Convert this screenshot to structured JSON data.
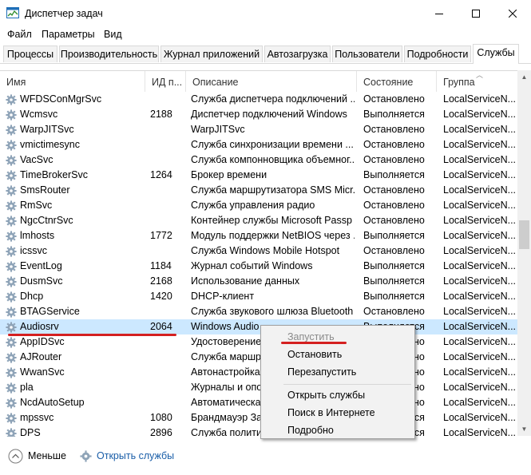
{
  "window": {
    "title": "Диспетчер задач",
    "minimize_icon": "minimize-icon",
    "maximize_icon": "maximize-icon",
    "close_icon": "close-icon"
  },
  "menu": [
    "Файл",
    "Параметры",
    "Вид"
  ],
  "tabs": [
    "Процессы",
    "Производительность",
    "Журнал приложений",
    "Автозагрузка",
    "Пользователи",
    "Подробности",
    "Службы"
  ],
  "active_tab": "Службы",
  "columns": [
    "Имя",
    "ИД п...",
    "Описание",
    "Состояние",
    "Группа"
  ],
  "rows": [
    {
      "name": "WFDSConMgrSvc",
      "pid": "",
      "desc": "Служба диспетчера подключений ...",
      "state": "Остановлено",
      "group": "LocalServiceN..."
    },
    {
      "name": "Wcmsvc",
      "pid": "2188",
      "desc": "Диспетчер подключений Windows",
      "state": "Выполняется",
      "group": "LocalServiceN..."
    },
    {
      "name": "WarpJITSvc",
      "pid": "",
      "desc": "WarpJITSvc",
      "state": "Остановлено",
      "group": "LocalServiceN..."
    },
    {
      "name": "vmictimesync",
      "pid": "",
      "desc": "Служба синхронизации времени ...",
      "state": "Остановлено",
      "group": "LocalServiceN..."
    },
    {
      "name": "VacSvc",
      "pid": "",
      "desc": "Служба компонновщика объемног...",
      "state": "Остановлено",
      "group": "LocalServiceN..."
    },
    {
      "name": "TimeBrokerSvc",
      "pid": "1264",
      "desc": "Брокер времени",
      "state": "Выполняется",
      "group": "LocalServiceN..."
    },
    {
      "name": "SmsRouter",
      "pid": "",
      "desc": "Служба маршрутизатора SMS Micr...",
      "state": "Остановлено",
      "group": "LocalServiceN..."
    },
    {
      "name": "RmSvc",
      "pid": "",
      "desc": "Служба управления радио",
      "state": "Остановлено",
      "group": "LocalServiceN..."
    },
    {
      "name": "NgcCtnrSvc",
      "pid": "",
      "desc": "Контейнер службы Microsoft Passp",
      "state": "Остановлено",
      "group": "LocalServiceN..."
    },
    {
      "name": "lmhosts",
      "pid": "1772",
      "desc": "Модуль поддержки NetBIOS через ...",
      "state": "Выполняется",
      "group": "LocalServiceN..."
    },
    {
      "name": "icssvc",
      "pid": "",
      "desc": "Служба Windows Mobile Hotspot",
      "state": "Остановлено",
      "group": "LocalServiceN..."
    },
    {
      "name": "EventLog",
      "pid": "1184",
      "desc": "Журнал событий Windows",
      "state": "Выполняется",
      "group": "LocalServiceN..."
    },
    {
      "name": "DusmSvc",
      "pid": "2168",
      "desc": "Использование данных",
      "state": "Выполняется",
      "group": "LocalServiceN..."
    },
    {
      "name": "Dhcp",
      "pid": "1420",
      "desc": "DHCP-клиент",
      "state": "Выполняется",
      "group": "LocalServiceN..."
    },
    {
      "name": "BTAGService",
      "pid": "",
      "desc": "Служба звукового шлюза Bluetooth",
      "state": "Остановлено",
      "group": "LocalServiceN..."
    },
    {
      "name": "Audiosrv",
      "pid": "2064",
      "desc": "Windows Audio",
      "state": "Выполняется",
      "group": "LocalServiceN...",
      "selected": true
    },
    {
      "name": "AppIDSvc",
      "pid": "",
      "desc": "Удостоверение приложения",
      "state": "Остановлено",
      "group": "LocalServiceN..."
    },
    {
      "name": "AJRouter",
      "pid": "",
      "desc": "Служба маршрутизатора AllJoyn",
      "state": "Остановлено",
      "group": "LocalServiceN..."
    },
    {
      "name": "WwanSvc",
      "pid": "",
      "desc": "Автонастройка WWAN",
      "state": "Остановлено",
      "group": "LocalServiceN..."
    },
    {
      "name": "pla",
      "pid": "",
      "desc": "Журналы и оповещения производит...",
      "state": "Остановлено",
      "group": "LocalServiceN..."
    },
    {
      "name": "NcdAutoSetup",
      "pid": "",
      "desc": "Автоматическая настройка сетевых...",
      "state": "Остановлено",
      "group": "LocalServiceN..."
    },
    {
      "name": "mpssvc",
      "pid": "1080",
      "desc": "Брандмауэр Защитника Windows",
      "state": "Выполняется",
      "group": "LocalServiceN..."
    },
    {
      "name": "DPS",
      "pid": "2896",
      "desc": "Служба политики диагностики",
      "state": "Выполняется",
      "group": "LocalServiceN..."
    }
  ],
  "context_menu": {
    "start": "Запустить",
    "stop": "Остановить",
    "restart": "Перезапустить",
    "open_services": "Открыть службы",
    "search_online": "Поиск в Интернете",
    "details": "Подробно"
  },
  "footer": {
    "less": "Меньше",
    "open_services": "Открыть службы"
  },
  "colors": {
    "selected_row": "#cce8ff",
    "link": "#1a5ea8",
    "annotation_red": "#d42020"
  }
}
